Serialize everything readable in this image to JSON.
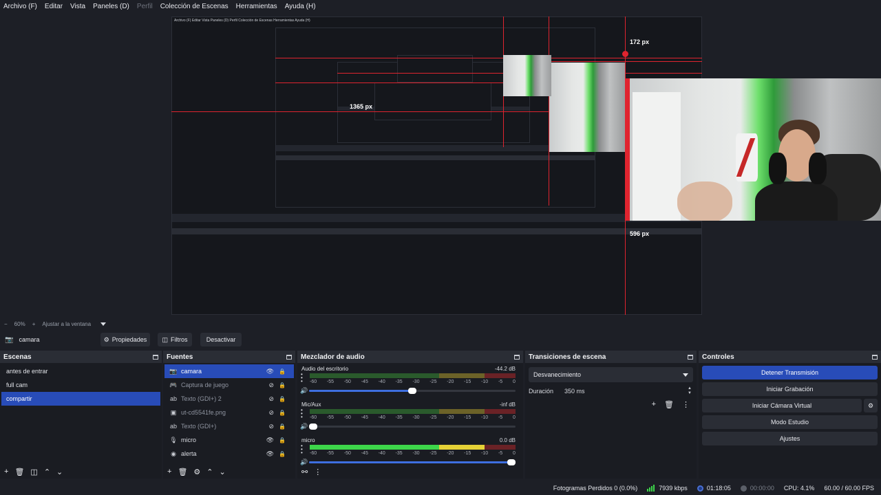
{
  "menu": [
    "Archivo (F)",
    "Editar",
    "Vista",
    "Paneles (D)",
    "Perfil",
    "Colección de Escenas",
    "Herramientas",
    "Ayuda (H)"
  ],
  "preview": {
    "overlay_labels": [
      "172 px",
      "1365 px",
      "596 px"
    ],
    "nested_menu": "Archivo (F)   Editar   Vista   Paneles (D)   Perfil   Colección de Escenas   Herramientas   Ayuda (H)"
  },
  "zoom": {
    "minus": "−",
    "value": "60%",
    "plus": "+",
    "fit": "Ajustar a la ventana"
  },
  "source_toolbar": {
    "name": "camara",
    "properties": "Propiedades",
    "filters": "Filtros",
    "deactivate": "Desactivar"
  },
  "scenes": {
    "title": "Escenas",
    "items": [
      "antes de entrar",
      "full cam",
      "compartir"
    ],
    "selected": 2
  },
  "sources": {
    "title": "Fuentes",
    "items": [
      {
        "label": "camara",
        "icon": "camera-icon",
        "glyph": "📷",
        "visible": true,
        "selected": true
      },
      {
        "label": "Captura de juego",
        "icon": "gamepad-icon",
        "glyph": "🎮",
        "visible": false
      },
      {
        "label": "Texto (GDI+) 2",
        "icon": "text-icon",
        "glyph": "ab",
        "visible": false
      },
      {
        "label": "ut-cd5541fe.png",
        "icon": "image-icon",
        "glyph": "▣",
        "visible": false
      },
      {
        "label": "Texto (GDI+)",
        "icon": "text-icon",
        "glyph": "ab",
        "visible": false
      },
      {
        "label": "micro",
        "icon": "microphone-icon",
        "glyph": "🎙",
        "visible": true
      },
      {
        "label": "alerta",
        "icon": "browser-icon",
        "glyph": "◉",
        "visible": true
      }
    ]
  },
  "mixer": {
    "title": "Mezclador de audio",
    "ticks": [
      "-60",
      "-55",
      "-50",
      "-45",
      "-40",
      "-35",
      "-30",
      "-25",
      "-20",
      "-15",
      "-10",
      "-5",
      "0"
    ],
    "channels": [
      {
        "name": "Audio del escritorio",
        "db": "-44.2 dB",
        "level": 0,
        "volume": 0.5,
        "active": false
      },
      {
        "name": "Mic/Aux",
        "db": "-inf dB",
        "level": 0,
        "volume": 0.0,
        "active": false
      },
      {
        "name": "micro",
        "db": "0.0 dB",
        "level": 0.9,
        "volume": 1.0,
        "active": true
      }
    ]
  },
  "transitions": {
    "title": "Transiciones de escena",
    "selected": "Desvanecimiento",
    "duration_label": "Duración",
    "duration_value": "350 ms"
  },
  "controls": {
    "title": "Controles",
    "stop_stream": "Detener Transmisión",
    "start_recording": "Iniciar Grabación",
    "start_virtual_cam": "Iniciar Cámara Virtual",
    "studio_mode": "Modo Estudio",
    "settings": "Ajustes"
  },
  "status": {
    "dropped_frames": "Fotogramas Perdidos 0 (0.0%)",
    "bitrate": "7939 kbps",
    "stream_time": "01:18:05",
    "record_time": "00:00:00",
    "cpu": "CPU: 4.1%",
    "fps": "60.00 / 60.00 FPS"
  },
  "colors": {
    "accent": "#284cb8",
    "red_guide": "#e0242f",
    "meter_green": "#3dd64a",
    "meter_yellow": "#e5d136"
  }
}
